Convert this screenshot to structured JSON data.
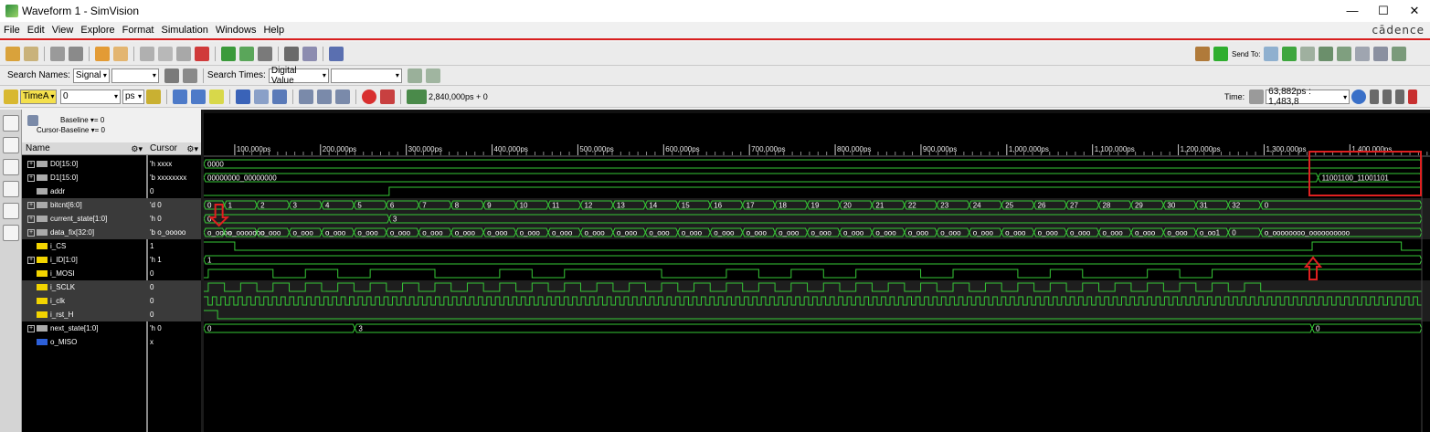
{
  "window": {
    "title": "Waveform 1 - SimVision",
    "minimize": "—",
    "maximize": "☐",
    "close": "✕"
  },
  "menu": [
    "File",
    "Edit",
    "View",
    "Explore",
    "Format",
    "Simulation",
    "Windows",
    "Help"
  ],
  "brand": "cādence",
  "search": {
    "names_label": "Search Names:",
    "names_mode": "Signal",
    "times_label": "Search Times:",
    "times_mode": "Digital Value"
  },
  "time_toolbar": {
    "marker": "TimeA",
    "time_value": "0",
    "unit": "ps",
    "sim_time": "2,840,000ps + 0",
    "time_label": "Time:",
    "time_range": "63,882ps : 1,483,8"
  },
  "send_to": "Send To:",
  "info": {
    "baseline": "Baseline ▾= 0",
    "cursor_baseline": "Cursor-Baseline ▾= 0"
  },
  "columns": {
    "name": "Name",
    "cursor": "Cursor"
  },
  "signals": [
    {
      "name": "D0[15:0]",
      "value": "'h xxxx",
      "kind": "bus",
      "expand": true
    },
    {
      "name": "D1[15:0]",
      "value": "'b xxxxxxxx",
      "kind": "bus",
      "expand": true
    },
    {
      "name": "addr",
      "value": "0",
      "kind": "bus",
      "expand": false
    },
    {
      "name": "bitcnt[6:0]",
      "value": "'d 0",
      "kind": "bus",
      "expand": true
    },
    {
      "name": "current_state[1:0]",
      "value": "'h 0",
      "kind": "bus",
      "expand": true
    },
    {
      "name": "data_fix[32:0]",
      "value": "'b o_ooooo",
      "kind": "bus",
      "expand": true
    },
    {
      "name": "i_CS",
      "value": "1",
      "kind": "in",
      "expand": false
    },
    {
      "name": "i_ID[1:0]",
      "value": "'h 1",
      "kind": "in",
      "expand": true
    },
    {
      "name": "i_MOSI",
      "value": "0",
      "kind": "in",
      "expand": false
    },
    {
      "name": "i_SCLK",
      "value": "0",
      "kind": "in",
      "expand": false
    },
    {
      "name": "i_clk",
      "value": "0",
      "kind": "in",
      "expand": false
    },
    {
      "name": "i_rst_H",
      "value": "0",
      "kind": "in",
      "expand": false
    },
    {
      "name": "next_state[1:0]",
      "value": "'h 0",
      "kind": "bus",
      "expand": true
    },
    {
      "name": "o_MISO",
      "value": "x",
      "kind": "out",
      "expand": false
    }
  ],
  "timeline": {
    "ticks": [
      "100,000ps",
      "200,000ps",
      "300,000ps",
      "400,000ps",
      "500,000ps",
      "600,000ps",
      "700,000ps",
      "800,000ps",
      "900,000ps",
      "1,000,000ps",
      "1,100,000ps",
      "1,200,000ps",
      "1,300,000ps",
      "1,400,000ps"
    ]
  },
  "wave_labels": {
    "d0": "0000",
    "d1_start": "00000000_00000000",
    "d1_end": "11001100_11001101",
    "bitcnt": [
      "0",
      "1",
      "2",
      "3",
      "4",
      "5",
      "6",
      "7",
      "8",
      "9",
      "10",
      "11",
      "12",
      "13",
      "14",
      "15",
      "16",
      "17",
      "18",
      "19",
      "20",
      "21",
      "22",
      "23",
      "24",
      "25",
      "26",
      "27",
      "28",
      "29",
      "30",
      "31",
      "32",
      "0"
    ],
    "current_state": [
      "0",
      "3"
    ],
    "data_fix_first": "o_oooo",
    "data_fix_second": "o_ooooooo",
    "data_fix_mid": "o_ooo",
    "data_fix_last_a": "o_oo1",
    "data_fix_last_b": "0",
    "data_fix_end": "o_oooooooo_oooooooooo",
    "i_id": "1",
    "next_state": [
      "0",
      "3",
      "0"
    ]
  },
  "colors": {
    "wave": "#36c836",
    "bg": "#000000",
    "highlight": "#e02020",
    "header": "#d8d8d8"
  }
}
